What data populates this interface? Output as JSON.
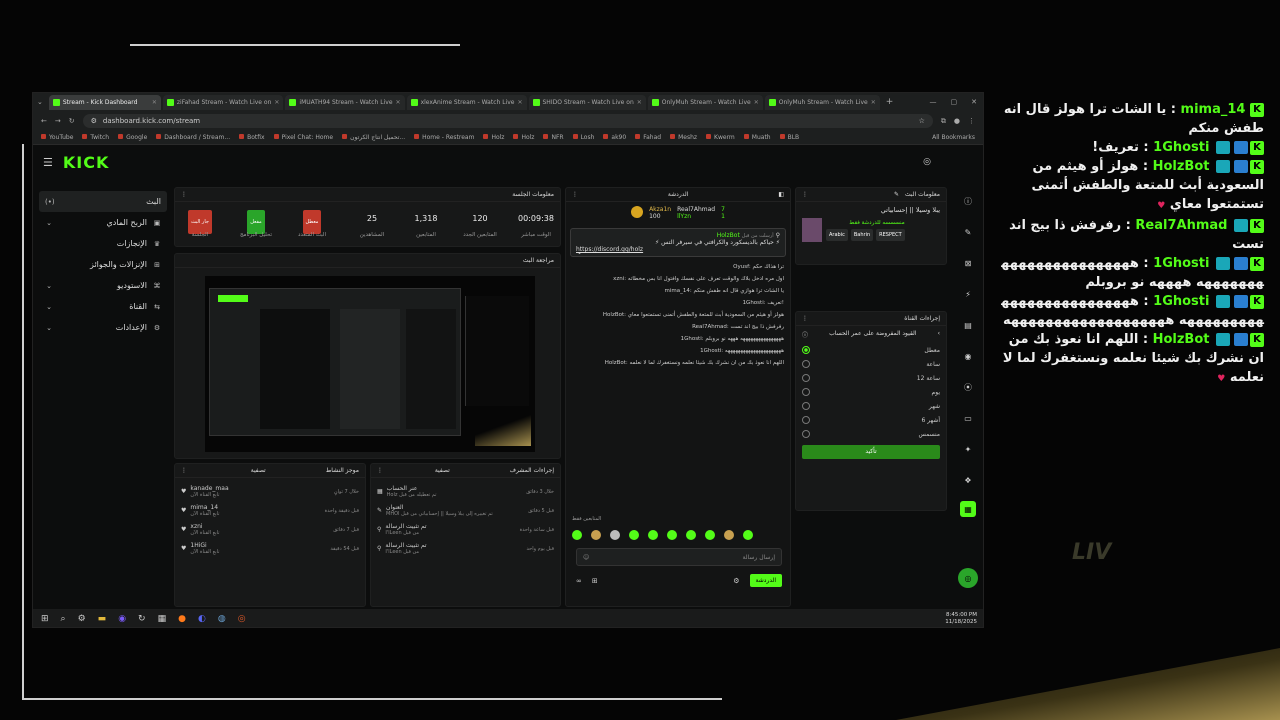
{
  "browser": {
    "tabs": [
      {
        "label": "Stream - Kick Dashboard",
        "active": true
      },
      {
        "label": "ziFahad Stream - Watch Live on"
      },
      {
        "label": "iMUATH94 Stream - Watch Live"
      },
      {
        "label": "xlexAnime Stream - Watch Live"
      },
      {
        "label": "SHIDO Stream - Watch Live on"
      },
      {
        "label": "OnlyMuh Stream - Watch Live"
      },
      {
        "label": "OnlyMuh Stream - Watch Live"
      }
    ],
    "url": "dashboard.kick.com/stream",
    "bookmarks": [
      "YouTube",
      "Twitch",
      "Google",
      "Dashboard / Stream...",
      "Botfix",
      "Pixel Chat: Home",
      "تحميل انتاج الكرتون...",
      "Home - Restream",
      "Holz",
      "Holz",
      "NFR",
      "Losh",
      "ak90",
      "Fahad",
      "Meshz",
      "Kwerm",
      "Muath",
      "BLB"
    ],
    "all_bookmarks": "All Bookmarks"
  },
  "kick": {
    "logo": "KICK",
    "sidebar": [
      {
        "label": "البث",
        "icon": "(•)"
      },
      {
        "label": "الربح المادي",
        "icon": "▣"
      },
      {
        "label": "الإنجازات",
        "icon": "♛"
      },
      {
        "label": "الإنزالات والجوائز",
        "icon": "⊞"
      },
      {
        "label": "الاستوديو",
        "icon": "⌘"
      },
      {
        "label": "القناة",
        "icon": "⇆"
      },
      {
        "label": "الإعدادات",
        "icon": "⚙"
      }
    ],
    "session": {
      "title": "معلومات الجلسة",
      "stats": [
        {
          "value": "00:09:38",
          "label": "الوقت مباشر"
        },
        {
          "value": "120",
          "label": "المتابعين الجدد"
        },
        {
          "value": "1,318",
          "label": "المتابعين"
        },
        {
          "value": "25",
          "label": "المشاهدين"
        },
        {
          "chip": "معطل",
          "chipColor": "#c0392b",
          "label": "البث المتعدد"
        },
        {
          "chip": "مفعل",
          "chipColor": "#2aa52a",
          "label": "تحليل البرنامج"
        },
        {
          "chip": "جار البث",
          "chipColor": "#c0392b",
          "label": "الجلسة"
        }
      ]
    },
    "preview_title": "مراجعة البث",
    "activity": {
      "title": "موجز النشاط",
      "filter": "تصفية",
      "items": [
        {
          "name": "kanade_maa",
          "sub": "تابع القناة الآن",
          "time": "خلال 7 ثوانٍ"
        },
        {
          "name": "mima_14",
          "sub": "تابع القناة الآن",
          "time": "قبل دقيقة واحدة"
        },
        {
          "name": "xzni",
          "sub": "تابع القناة الآن",
          "time": "قبل 7 دقائق"
        },
        {
          "name": "1HiGi",
          "sub": "تابع القناة الآن",
          "time": "قبل 54 دقيقة"
        }
      ]
    },
    "mod": {
      "title": "إجراءات المشرف",
      "filter": "تصفية",
      "items": [
        {
          "title": "عنر الحساب",
          "sub": "Holz تم تعطيله من قبل",
          "time": "خلال 3 دقائق"
        },
        {
          "title": "العنوان",
          "sub": "MHOI تم تغييره إلى يبلا وسيلا || إحسابياتي من قبل",
          "time": "قبل 5 دقائق"
        },
        {
          "title": "تم تثبيت الرسالة",
          "sub": "I'lLeen من قبل",
          "time": "قبل ساعة واحدة"
        },
        {
          "title": "تم تثبيت الرسالة",
          "sub": "I'lLeen من قبل",
          "time": "قبل يوم واحد"
        }
      ]
    },
    "chat": {
      "title": "الدردشة",
      "top_users": [
        {
          "name": "Akza1n",
          "count": "100"
        },
        {
          "name": "Real7Ahmad",
          "count": "7"
        },
        {
          "name": "llYzn",
          "count": "1"
        }
      ],
      "pinned": {
        "by": "أرسلت من قبل",
        "user": "HolzBot",
        "text": "⚡ حياكم بالديسكورد والكرافتي في سيرفر التس ⚡",
        "link": "https://discord.gg/holz"
      },
      "lines": [
        "Oyusf: ترا هذاك حكم",
        "xzni: اول مره ادخل بلاك والوقت تعرف على نفسك وافتول انا بس مخطاته",
        "mima_14: يا الشات ترا هوازي قال انه طفش منكم",
        "1Ghosti: تعريف!",
        "HolzBot: هولز أو هيثم من السعودية أبث للمتعة والطفش أتمنى تستمتعوا معاي",
        "Real7Ahmad: رفرفش ذا بيج اند تست",
        "1Ghosti: ههههههههههههههههه هههه نو بروبلم",
        "1Ghosti: ههههههههههههههههههههههه",
        "HolzBot: اللهم انا نعوذ بك من ان نشرك بك شيئا نعلمه ونستغفرك لما لا نعلمه"
      ],
      "followers_only": "المتابعين فقط",
      "input_placeholder": "إرسال رسالة",
      "send": "الدردشة"
    },
    "stream_info": {
      "title": "معلومات البث",
      "stream_title": "يبلا وسيلا || إحسابياتي",
      "category": "منسسسه للدردشة فقط",
      "tags": [
        "Arabic",
        "Bahrin",
        "RESPECT"
      ]
    },
    "channel_actions": {
      "title": "إجراءات القناة",
      "subtitle": "القيود المفروضة على عمر الحساب",
      "options": [
        {
          "label": "معطل",
          "selected": true
        },
        {
          "label": "ساعة"
        },
        {
          "label": "12 ساعة"
        },
        {
          "label": "يوم"
        },
        {
          "label": "شهر"
        },
        {
          "label": "6 أشهر"
        },
        {
          "label": "منسمس"
        }
      ],
      "confirm": "تأكيد"
    },
    "taskbar_time": "8:45:00 PM",
    "taskbar_date": "11/18/2025"
  },
  "overlay_chat": [
    {
      "user": "mima_14",
      "text": "يا الشات ترا هولز قال انه طفش منكم"
    },
    {
      "user": "1Ghosti",
      "text": "تعريف!"
    },
    {
      "user": "HolzBot",
      "text": "هولز أو هيثم من السعودية أبث للمتعة والطفش أتمنى تستمتعوا معاي"
    },
    {
      "user": "Real7Ahmad",
      "text": "رفرفش ذا بيج اند تست"
    },
    {
      "user": "1Ghosti",
      "text": "هههههههههههههههههههههههه ههههه نو بروبلم"
    },
    {
      "user": "1Ghosti",
      "text": "هههههههههههههههههههههههههه هههههههههههههههههههه"
    },
    {
      "user": "HolzBot",
      "text": "اللهم انا نعوذ بك من ان نشرك بك شيئا نعلمه ونستغفرك لما لا نعلمه"
    }
  ],
  "watermark": "LIV",
  "colors": {
    "accent": "#53fc18",
    "danger": "#c0392b",
    "gold": "#a6904e"
  }
}
